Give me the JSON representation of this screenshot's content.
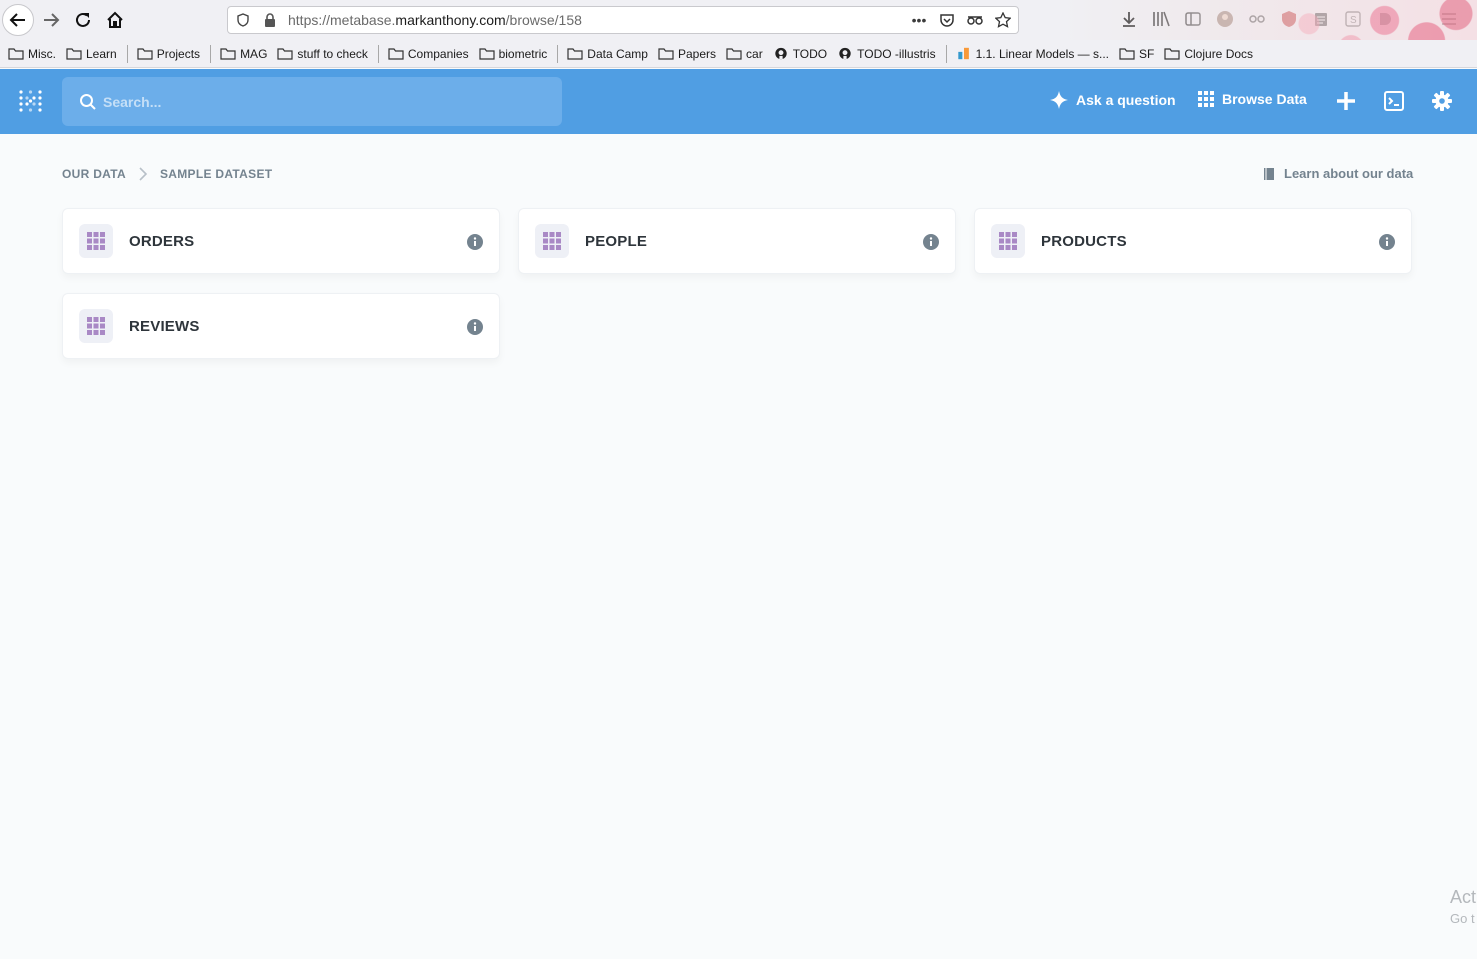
{
  "browser": {
    "url_prefix": "https://metabase.",
    "url_host": "markanthony.com",
    "url_path": "/browse/158",
    "bookmarks": [
      {
        "label": "Misc.",
        "icon": "folder-icon"
      },
      {
        "label": "Learn",
        "icon": "folder-icon"
      },
      {
        "label": "Projects",
        "icon": "folder-icon"
      },
      {
        "label": "MAG",
        "icon": "folder-icon"
      },
      {
        "label": "stuff to check",
        "icon": "folder-icon"
      },
      {
        "label": "Companies",
        "icon": "folder-icon"
      },
      {
        "label": "biometric",
        "icon": "folder-icon"
      },
      {
        "label": "Data Camp",
        "icon": "folder-icon"
      },
      {
        "label": "Papers",
        "icon": "folder-icon"
      },
      {
        "label": "car",
        "icon": "folder-icon"
      },
      {
        "label": "TODO",
        "icon": "github-icon"
      },
      {
        "label": "TODO -illustris",
        "icon": "github-icon"
      },
      {
        "label": "1.1. Linear Models — s...",
        "icon": "sklearn-icon"
      },
      {
        "label": "SF",
        "icon": "folder-icon"
      },
      {
        "label": "Clojure Docs",
        "icon": "folder-icon"
      }
    ],
    "badges": {
      "shield_count": "1",
      "ext_count": "1"
    }
  },
  "nav": {
    "search_placeholder": "Search...",
    "ask_label": "Ask a question",
    "browse_label": "Browse Data",
    "brand_color": "#509ee3"
  },
  "breadcrumb": {
    "root": "OUR DATA",
    "current": "SAMPLE DATASET"
  },
  "learn_label": "Learn about our data",
  "tables": [
    {
      "name": "ORDERS"
    },
    {
      "name": "PEOPLE"
    },
    {
      "name": "PRODUCTS"
    },
    {
      "name": "REVIEWS"
    }
  ],
  "watermark": {
    "line1": "Act",
    "line2": "Go t"
  }
}
